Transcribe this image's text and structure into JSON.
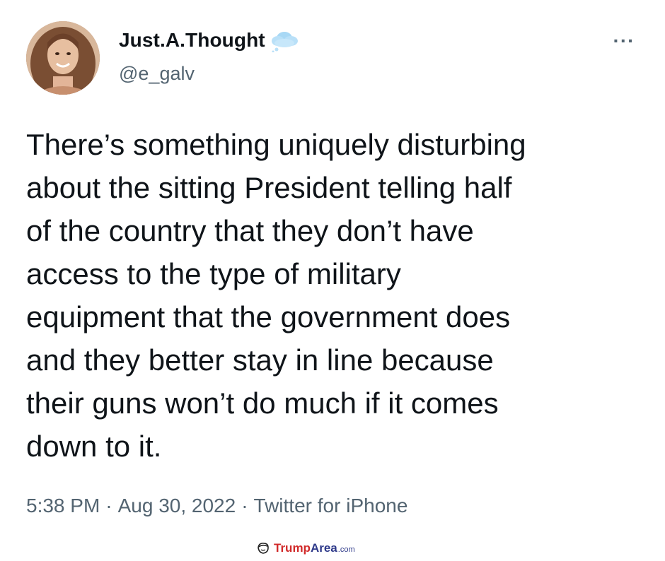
{
  "author": {
    "display_name": "Just.A.Thought",
    "handle": "@e_galv",
    "name_emoji": "cloud-icon"
  },
  "tweet": {
    "text_lines": [
      "There’s something uniquely disturbing",
      "about the sitting President telling half",
      "of the country that they don’t have",
      "access to the type of military",
      "equipment that the government does",
      "and they better stay in line because",
      "their guns won’t do much if it comes",
      "down to it."
    ],
    "time": "5:38 PM",
    "date": "Aug 30, 2022",
    "source": "Twitter for iPhone",
    "separator": "·"
  },
  "menu": {
    "more_label": "···"
  },
  "watermark": {
    "part1": "Trump",
    "part2": "Area",
    "part3": ".com"
  },
  "colors": {
    "text": "#0f1419",
    "secondary": "#536471",
    "watermark_red": "#d12a2a",
    "watermark_blue": "#2f3a8a"
  }
}
